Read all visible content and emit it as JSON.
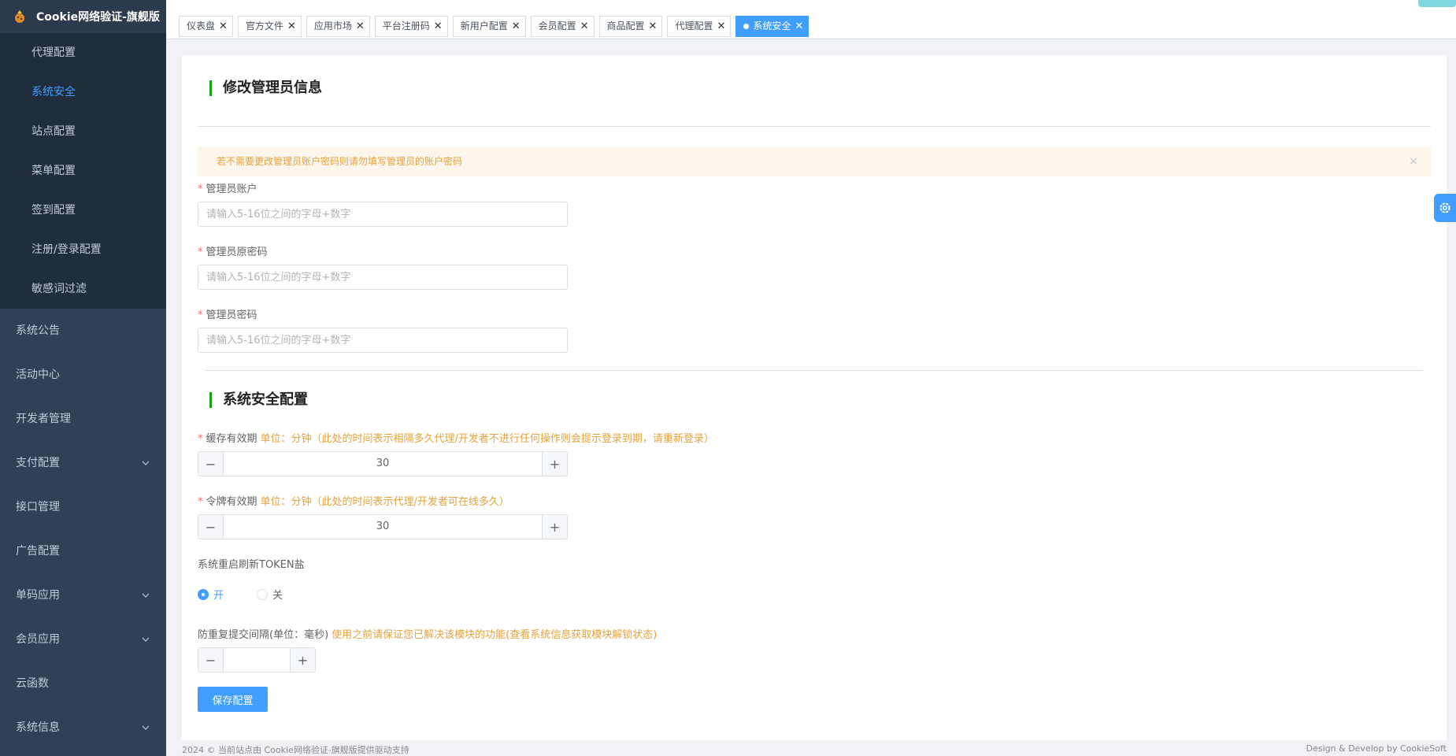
{
  "app": {
    "title": "Cookie网络验证-旗舰版"
  },
  "sidebar": {
    "sub_items": [
      {
        "label": "代理配置",
        "active": false
      },
      {
        "label": "系统安全",
        "active": true
      },
      {
        "label": "站点配置",
        "active": false
      },
      {
        "label": "菜单配置",
        "active": false
      },
      {
        "label": "签到配置",
        "active": false
      },
      {
        "label": "注册/登录配置",
        "active": false
      },
      {
        "label": "敏感词过滤",
        "active": false
      }
    ],
    "items": [
      {
        "label": "系统公告",
        "expandable": false
      },
      {
        "label": "活动中心",
        "expandable": false
      },
      {
        "label": "开发者管理",
        "expandable": false
      },
      {
        "label": "支付配置",
        "expandable": true
      },
      {
        "label": "接口管理",
        "expandable": false
      },
      {
        "label": "广告配置",
        "expandable": false
      },
      {
        "label": "单码应用",
        "expandable": true
      },
      {
        "label": "会员应用",
        "expandable": true
      },
      {
        "label": "云函数",
        "expandable": false
      },
      {
        "label": "系统信息",
        "expandable": true
      }
    ]
  },
  "tabs": [
    {
      "label": "仪表盘",
      "active": false
    },
    {
      "label": "官方文件",
      "active": false
    },
    {
      "label": "应用市场",
      "active": false
    },
    {
      "label": "平台注册码",
      "active": false
    },
    {
      "label": "新用户配置",
      "active": false
    },
    {
      "label": "会员配置",
      "active": false
    },
    {
      "label": "商品配置",
      "active": false
    },
    {
      "label": "代理配置",
      "active": false
    },
    {
      "label": "系统安全",
      "active": true
    }
  ],
  "admin_section": {
    "title": "修改管理员信息",
    "alert": "若不需要更改管理员账户密码则请勿填写管理员的账户密码",
    "alert_close": "×",
    "account_label": "管理员账户",
    "account_placeholder": "请输入5-16位之间的字母+数字",
    "old_password_label": "管理员原密码",
    "old_password_placeholder": "请输入5-16位之间的字母+数字",
    "password_label": "管理员密码",
    "password_placeholder": "请输入5-16位之间的字母+数字"
  },
  "security_section": {
    "title": "系统安全配置",
    "cache_label": "缓存有效期",
    "cache_hint": "单位：分钟（此处的时间表示相隔多久代理/开发者不进行任何操作则会提示登录到期，请重新登录）",
    "cache_value": "30",
    "token_label": "令牌有效期",
    "token_hint": "单位：分钟（此处的时间表示代理/开发者可在线多久）",
    "token_value": "30",
    "refresh_label": "系统重启刷新TOKEN盐",
    "radio_on": "开",
    "radio_off": "关",
    "refresh_enabled": true,
    "resubmit_label": "防重复提交间隔(单位：毫秒)",
    "resubmit_hint": "使用之前请保证您已解决该模块的功能(查看系统信息获取模块解锁状态)",
    "resubmit_value": "",
    "save_label": "保存配置"
  },
  "stepper": {
    "minus": "−",
    "plus": "+"
  },
  "footer": {
    "left": "2024 © 当前站点由 Cookie网络验证-旗舰版提供驱动支持",
    "right": "Design & Develop by CookieSoft"
  },
  "colors": {
    "sidebar_bg": "#304156",
    "accent": "#409eff",
    "section_bar": "#13a10e",
    "hint": "#e6a23c"
  }
}
